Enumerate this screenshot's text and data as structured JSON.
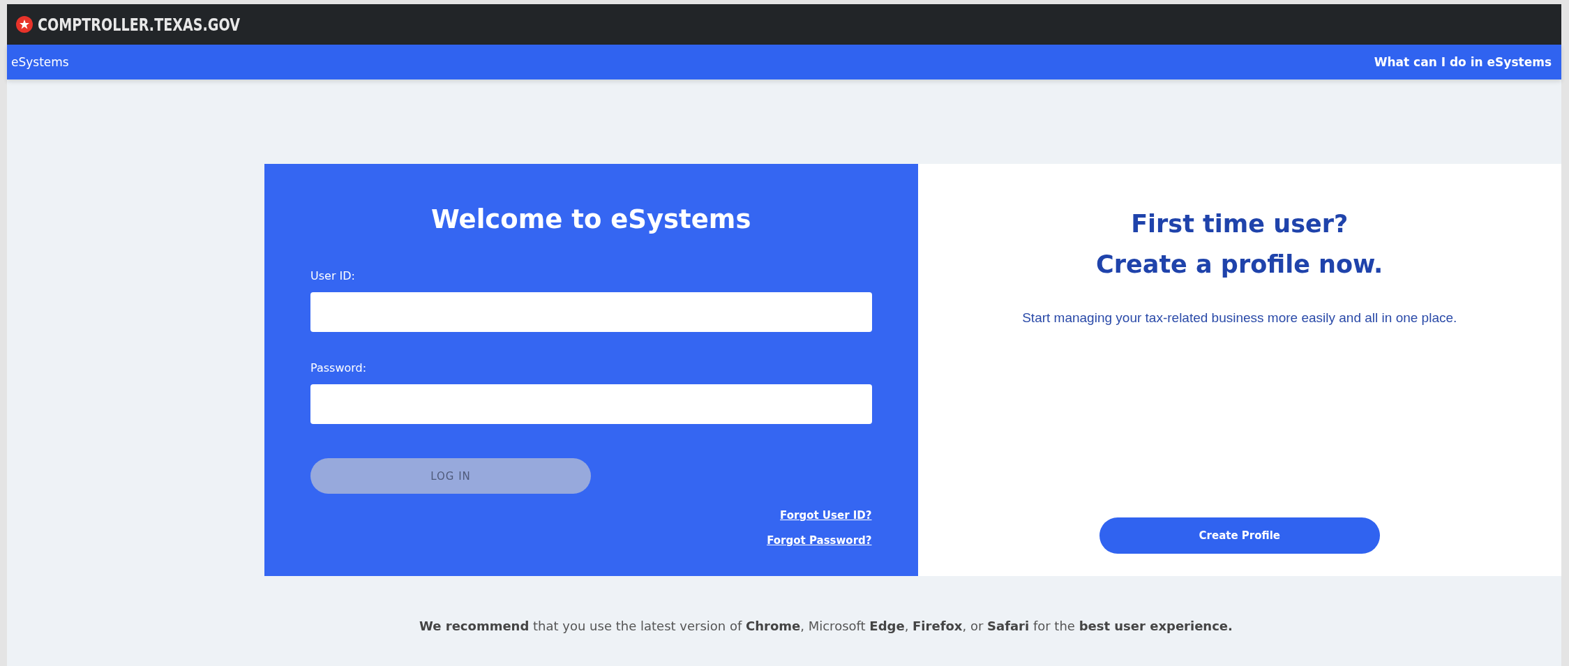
{
  "top_bar": {
    "site_title": "COMPTROLLER.TEXAS.GOV"
  },
  "nav_bar": {
    "app_name": "eSystems",
    "help_link": "What can I do in eSystems"
  },
  "login": {
    "title": "Welcome to eSystems",
    "fields": [
      {
        "label": "User ID:"
      },
      {
        "label": "Password:"
      }
    ],
    "login_button": {
      "label": "LOG IN",
      "disabled": true
    },
    "links": [
      "Forgot User ID?",
      "Forgot Password?"
    ]
  },
  "signup": {
    "title_lines": [
      "First time user?",
      "Create a profile now."
    ],
    "description": "Start managing your tax-related business more easily and all in one place.",
    "button": "Create Profile"
  },
  "footer_note": "**We recommend** that you use the latest version of **Chrome**, Microsoft **Edge**, **Firefox**, or **Safari** for the **best user experience.**"
}
